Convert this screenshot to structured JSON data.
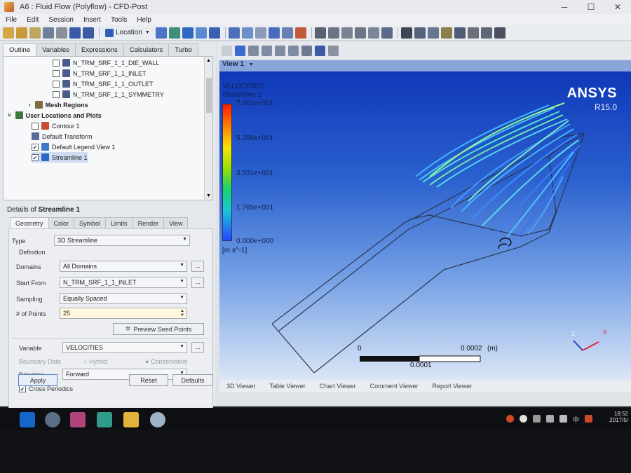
{
  "window": {
    "title": "A6 : Fluid Flow (Polyflow) - CFD-Post",
    "btn_min": "─",
    "btn_max": "☐",
    "btn_close": "✕"
  },
  "menu": [
    "File",
    "Edit",
    "Session",
    "Insert",
    "Tools",
    "Help"
  ],
  "toolbar": {
    "location_label": "Location"
  },
  "outline_tabs": [
    "Outline",
    "Variables",
    "Expressions",
    "Calculators",
    "Turbo"
  ],
  "tree": {
    "rows": [
      {
        "label": "N_TRM_SRF_1_1_DIE_WALL",
        "checked": false
      },
      {
        "label": "N_TRM_SRF_1_1_INLET",
        "checked": false
      },
      {
        "label": "N_TRM_SRF_1_1_OUTLET",
        "checked": false
      },
      {
        "label": "N_TRM_SRF_1_1_SYMMETRY",
        "checked": false
      },
      {
        "label": "Mesh Regions"
      },
      {
        "label": "User Locations and Plots"
      },
      {
        "label": "Contour 1",
        "checked": false
      },
      {
        "label": "Default Transform"
      },
      {
        "label": "Default Legend View 1",
        "checked": true
      },
      {
        "label": "Streamline 1",
        "checked": true
      }
    ]
  },
  "details": {
    "title_prefix": "Details of",
    "title_obj": "Streamline 1",
    "tabs": [
      "Geometry",
      "Color",
      "Symbol",
      "Limits",
      "Render",
      "View"
    ],
    "type_label": "Type",
    "type_value": "3D Streamline",
    "definition_label": "Definition",
    "domains_label": "Domains",
    "domains_value": "All Domains",
    "start_label": "Start From",
    "start_value": "N_TRM_SRF_1_1_INLET",
    "sampling_label": "Sampling",
    "sampling_value": "Equally Spaced",
    "points_label": "# of Points",
    "points_value": "25",
    "preview_label": "Preview Seed Points",
    "variable_label": "Variable",
    "variable_value": "VELOCITIES",
    "boundary_label": "Boundary Data",
    "hybrid_label": "Hybrid",
    "conservative_label": "Conservative",
    "direction_label": "Direction",
    "direction_value": "Forward",
    "cross_label": "Cross Periodics",
    "dots": "...",
    "apply": "Apply",
    "reset": "Reset",
    "defaults": "Defaults"
  },
  "viewer": {
    "view_label": "View 1",
    "legend_title": "VELOCITIES",
    "legend_sub": "Streamline 1",
    "ticks": [
      "7.061e+001",
      "5.296e+001",
      "3.531e+001",
      "1.765e+001",
      "0.000e+000"
    ],
    "units": "[m s^-1]",
    "brand": "ANSYS",
    "version": "R15.0",
    "scale_left": "0",
    "scale_right": "0.0002",
    "scale_unit": "(m)",
    "scale_mid": "0.0001",
    "axis_z": "Z",
    "axis_x": "X",
    "tabs": [
      "3D Viewer",
      "Table Viewer",
      "Chart Viewer",
      "Comment Viewer",
      "Report Viewer"
    ]
  },
  "taskbar": {
    "time": "18:52",
    "date": "2017/5/",
    "ime": "中"
  }
}
